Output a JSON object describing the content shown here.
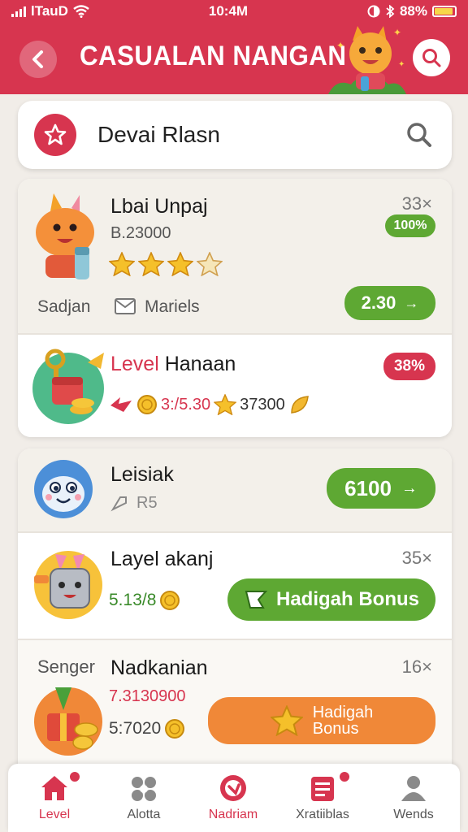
{
  "status_bar": {
    "carrier": "lTauD",
    "time": "10:4M",
    "battery": "88%"
  },
  "header": {
    "title": "CASUALAN NANGAN"
  },
  "search": {
    "value": "Devai Rlasn"
  },
  "items": [
    {
      "title": "Lbai Unpaj",
      "subtitle": "B.23000",
      "count": "33×",
      "percent": "100%",
      "stars": 3.5,
      "footer_left": "Sadjan",
      "footer_mid": "Mariels",
      "button": "2.30"
    },
    {
      "title_accent": "Level",
      "title_rest": " Hanaan",
      "percent": "38%",
      "value_a": "3:/5.30",
      "value_b": "37300"
    },
    {
      "title": "Leisiak",
      "subtitle": "R5",
      "button": "6100"
    },
    {
      "title": "Layel akanj",
      "count": "35×",
      "value": "5.13/8",
      "button": "Hadigah Bonus"
    },
    {
      "header_left": "Senger",
      "title": "Nadkanian",
      "count": "16×",
      "value_a": "7.3130900",
      "value_b": "5:7020",
      "button_line1": "Hadigah",
      "button_line2": "Bonus"
    }
  ],
  "bottom_nav": [
    {
      "label": "Level",
      "icon": "home-icon",
      "active": true
    },
    {
      "label": "Alotta",
      "icon": "controller-icon",
      "active": false
    },
    {
      "label": "Nadriam",
      "icon": "target-icon",
      "active": false
    },
    {
      "label": "Xratiiblas",
      "icon": "list-icon",
      "active": false
    },
    {
      "label": "Wends",
      "icon": "person-icon",
      "active": false
    }
  ],
  "colors": {
    "brand": "#d7354f",
    "green": "#5ea833",
    "orange": "#f08838",
    "background": "#f1ede8"
  }
}
